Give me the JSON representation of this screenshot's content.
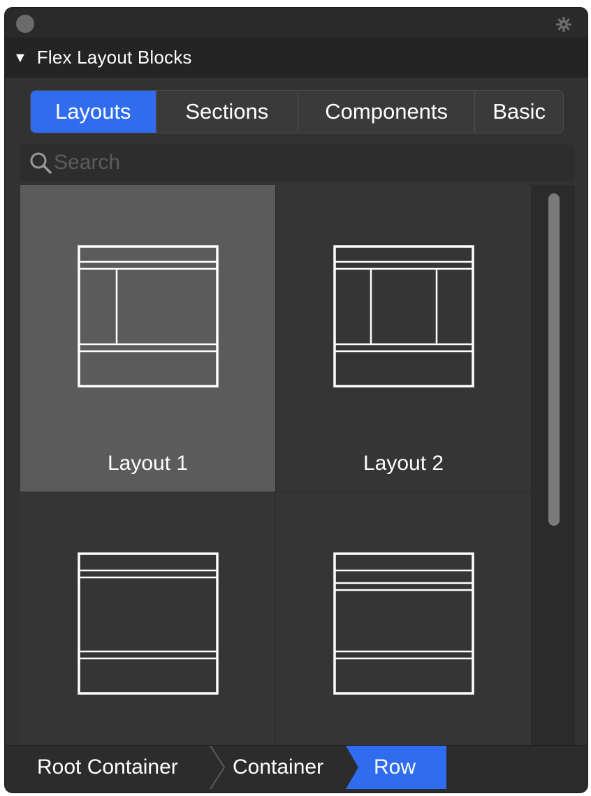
{
  "panel": {
    "title": "Flex Layout Blocks"
  },
  "tabs": [
    {
      "label": "Layouts",
      "active": true
    },
    {
      "label": "Sections",
      "active": false
    },
    {
      "label": "Components",
      "active": false
    },
    {
      "label": "Basic",
      "active": false
    }
  ],
  "search": {
    "placeholder": "Search",
    "value": ""
  },
  "layouts": [
    {
      "label": "Layout 1",
      "selected": true
    },
    {
      "label": "Layout 2",
      "selected": false
    },
    {
      "label": "",
      "selected": false
    },
    {
      "label": "",
      "selected": false
    }
  ],
  "breadcrumb": [
    {
      "label": "Root Container",
      "active": false
    },
    {
      "label": "Container",
      "active": false
    },
    {
      "label": "Row",
      "active": true
    }
  ],
  "colors": {
    "accent": "#2f6cf0",
    "panel_bg": "#323232",
    "selected_cell": "#5c5b5b"
  },
  "icons": [
    "close-dot",
    "gear-icon",
    "disclosure-triangle-icon",
    "search-icon",
    "chevron-right-icon"
  ]
}
